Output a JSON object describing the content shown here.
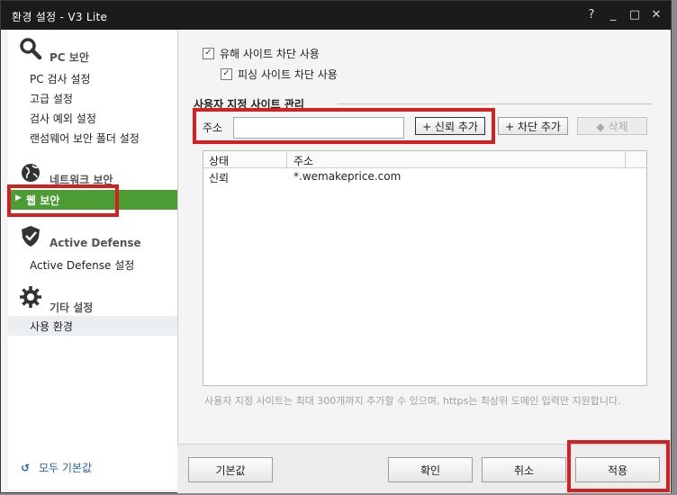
{
  "window": {
    "title": "환경 설정 - V3 Lite",
    "help": "?",
    "minimize": "_",
    "maximize": "□",
    "close": "✕"
  },
  "sidebar": {
    "categories": [
      {
        "label": "PC 보안",
        "items": [
          "PC 검사 설정",
          "고급 설정",
          "검사 예외 설정",
          "랜섬웨어 보안 폴더 설정"
        ]
      },
      {
        "label": "네트워크 보안",
        "items": [
          "웹 보안"
        ]
      },
      {
        "label": "Active Defense",
        "items": [
          "Active Defense 설정"
        ]
      },
      {
        "label": "기타 설정",
        "items": [
          "사용 환경"
        ]
      }
    ],
    "reset_all": "모두 기본값"
  },
  "main": {
    "block_harmful": "유해 사이트 차단 사용",
    "block_phishing": "피싱 사이트 차단 사용",
    "section_title": "사용자 지정 사이트 관리",
    "address_label": "주소",
    "address_value": "",
    "add_trust": "+ 신뢰 추가",
    "add_block": "+ 차단 추가",
    "delete": "삭제",
    "table": {
      "headers": [
        "상태",
        "주소"
      ],
      "rows": [
        {
          "status": "신뢰",
          "address": "*.wemakeprice.com"
        }
      ]
    },
    "note": "사용자 지정 사이트는 최대 300개까지 추가할 수 있으며, https는 최상위 도메인 입력만 지원합니다."
  },
  "footer": {
    "default": "기본값",
    "ok": "확인",
    "cancel": "취소",
    "apply": "적용"
  },
  "colors": {
    "active_nav": "#4b9d33",
    "highlight": "#d42020",
    "link": "#2a64b4"
  }
}
